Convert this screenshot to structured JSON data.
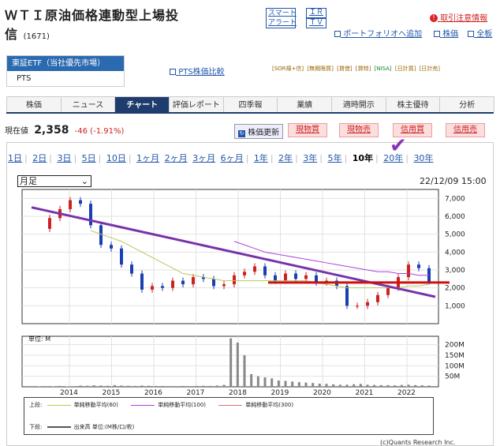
{
  "header": {
    "title": "ＷＴＩ原油価格連動型上場投信",
    "code": "(1671)",
    "buttons": [
      {
        "label": "スマート\nアラート"
      },
      {
        "label": "ＩＲ"
      },
      {
        "label": "ＴＶ"
      }
    ],
    "alert_link": "取引注意情報",
    "portfolio_link": "ポートフォリオへ追加",
    "stock_link": "株価",
    "all_link": "全板"
  },
  "market": {
    "selected": "東証ETF（当社優先市場）",
    "other": "PTS",
    "compare_link": "PTS株価比較",
    "tags": [
      "[SOR規+信]",
      "[無期限買]",
      "[貸借]",
      "[貸特]",
      "[NISA]",
      "[日計買]",
      "[日計売]"
    ]
  },
  "tabs": [
    "株価",
    "ニュース",
    "チャート",
    "評価レポート",
    "四季報",
    "業績",
    "適時開示",
    "株主優待",
    "分析"
  ],
  "active_tab": "チャート",
  "quote": {
    "label": "現在値",
    "price": "2,358",
    "change": "-46 (-1.91%)",
    "refresh": "株価更新"
  },
  "actions": [
    "現物買",
    "現物売",
    "信用買",
    "信用売"
  ],
  "periods": [
    "1日",
    "2日",
    "3日",
    "5日",
    "10日",
    "1ヶ月",
    "2ヶ月",
    "3ヶ月",
    "6ヶ月",
    "1年",
    "2年",
    "3年",
    "5年",
    "10年",
    "20年",
    "30年"
  ],
  "active_period": "10年",
  "select_value": "月足",
  "datetime": "22/12/09 15:00",
  "colors": {
    "up": "#cc2222",
    "down": "#1a3fb0",
    "ma60": "#b5c95a",
    "ma100": "#aa44dd",
    "ma300": "#e87070",
    "trend": "#7733aa",
    "support": "#cc1111",
    "volume": "#888888"
  },
  "chart_data": [
    {
      "type": "line",
      "title": "",
      "x_ticks": [
        "2014",
        "2015",
        "2016",
        "2017",
        "2018",
        "2019",
        "2020",
        "2021",
        "2022"
      ],
      "ylim": [
        0,
        7500
      ],
      "y_ticks": [
        "7,000",
        "6,000",
        "5,000",
        "4,000",
        "3,000",
        "2,000",
        "1,000"
      ],
      "series": [
        {
          "name": "月足",
          "values": [
            5300,
            5900,
            6400,
            6900,
            6700,
            5500,
            4400,
            4200,
            3300,
            2800,
            1900,
            2100,
            2000,
            2400,
            2200,
            2600,
            2500,
            2100,
            2200,
            2700,
            2900,
            3200,
            2700,
            2400,
            2800,
            2500,
            2700,
            2300,
            2400,
            2100,
            1000,
            1000,
            1200,
            1600,
            2000,
            2600,
            3300,
            3100,
            2358
          ]
        },
        {
          "name": "単純移動平均(60)",
          "values": [
            null,
            null,
            null,
            null,
            null,
            5200,
            5000,
            4800,
            4600,
            4300,
            4000,
            3700,
            3400,
            3100,
            2800,
            2700,
            2600,
            2500,
            2400,
            2400,
            2400,
            2400,
            2400,
            2400,
            2400,
            2400,
            2400,
            2300,
            2200,
            2100,
            2000,
            2000,
            2000,
            2000,
            2000,
            2000,
            2100,
            2100,
            2200
          ]
        },
        {
          "name": "単純移動平均(100)",
          "values": [
            null,
            null,
            null,
            null,
            null,
            null,
            null,
            null,
            null,
            null,
            null,
            null,
            null,
            null,
            null,
            null,
            null,
            null,
            null,
            4600,
            4400,
            4200,
            4000,
            3900,
            3800,
            3700,
            3600,
            3500,
            3400,
            3300,
            3200,
            3100,
            3000,
            2900,
            2900,
            2800,
            2800,
            2700,
            2700
          ]
        }
      ],
      "annotations": [
        "downtrend line",
        "support line at ~2,300"
      ]
    },
    {
      "type": "bar",
      "title": "単位: M",
      "y_ticks": [
        "200M",
        "150M",
        "100M",
        "50M"
      ],
      "ylim": [
        0,
        240
      ],
      "values": [
        2,
        3,
        2,
        4,
        2,
        3,
        6,
        5,
        7,
        6,
        5,
        8,
        6,
        5,
        4,
        6,
        5,
        4,
        4,
        3,
        3,
        4,
        3,
        4,
        5,
        4,
        6,
        9,
        230,
        210,
        150,
        60,
        50,
        45,
        40,
        30,
        28,
        25,
        22,
        20,
        18,
        15,
        14,
        12,
        10,
        10,
        12,
        14,
        10,
        9,
        8,
        8,
        7,
        9,
        10,
        8,
        7,
        6
      ]
    }
  ],
  "legend": {
    "upper_label": "上段:",
    "lower_label": "下段:",
    "items": [
      "単純移動平均(60)",
      "単純移動平均(100)",
      "単純移動平均(300)"
    ],
    "volume_label": "出来高 単位:(M株/口/枚)"
  },
  "copyright": "(c)Quants Research Inc."
}
